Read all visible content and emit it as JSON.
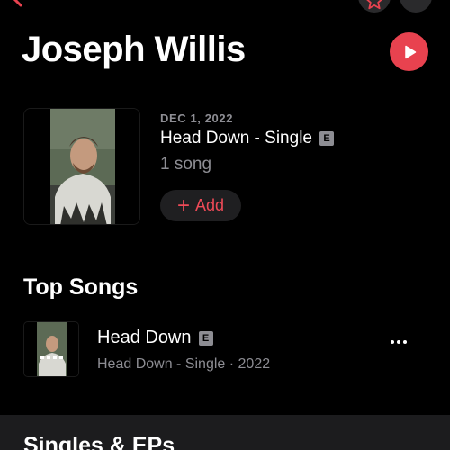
{
  "nav": {
    "back_icon": "chevron-left-icon",
    "favorite_icon": "star-icon",
    "more_icon": "ellipsis-icon"
  },
  "artist": {
    "name": "Joseph Willis",
    "play_icon": "play-icon"
  },
  "latest_release": {
    "date": "DEC 1, 2022",
    "title": "Head Down - Single",
    "explicit_badge": "E",
    "song_count": "1 song",
    "add_label": "Add",
    "add_icon": "plus-icon"
  },
  "top_songs": {
    "heading": "Top Songs",
    "items": [
      {
        "title": "Head Down",
        "explicit_badge": "E",
        "subtitle": "Head Down - Single · 2022",
        "more_icon": "ellipsis-icon"
      }
    ]
  },
  "singles_section": {
    "heading": "Singles & EPs"
  },
  "colors": {
    "accent": "#e8424f",
    "background": "#000000",
    "secondary_text": "#8d8d93",
    "button_bg": "#1f1f21"
  }
}
